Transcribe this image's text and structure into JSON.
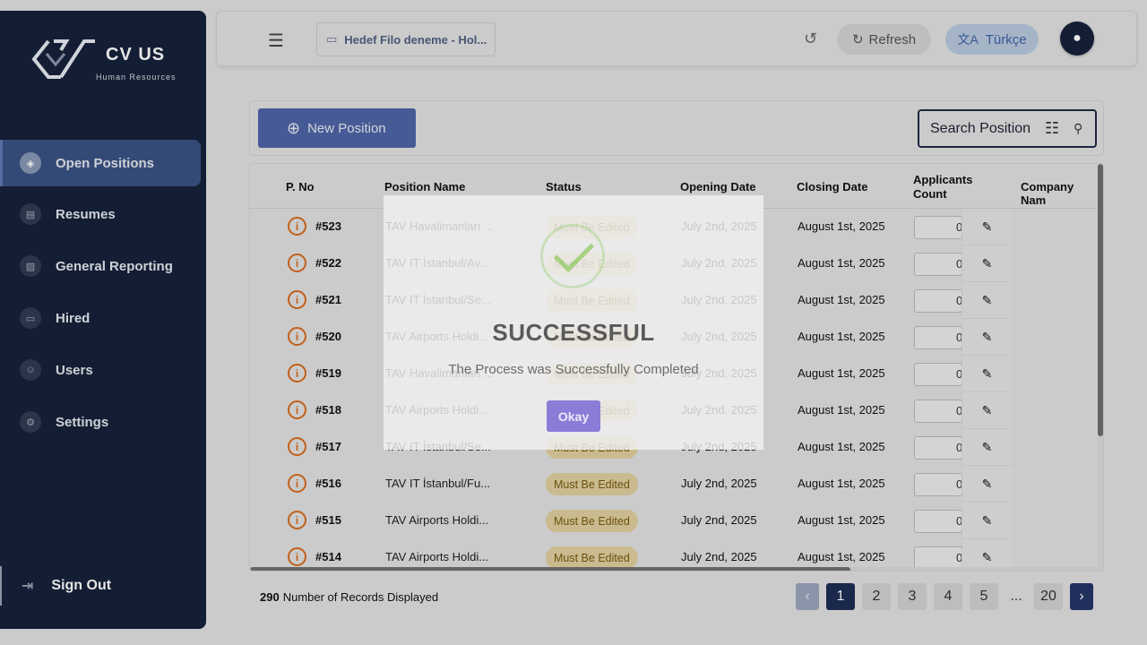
{
  "sidebar": {
    "logo_text": "CV US",
    "logo_sub": "Human Resources",
    "items": [
      {
        "label": "Open Positions",
        "icon": "layers-icon"
      },
      {
        "label": "Resumes",
        "icon": "document-icon"
      },
      {
        "label": "General Reporting",
        "icon": "chart-icon"
      },
      {
        "label": "Hired",
        "icon": "briefcase-icon"
      },
      {
        "label": "Users",
        "icon": "users-icon"
      },
      {
        "label": "Settings",
        "icon": "gear-icon"
      }
    ],
    "signout_label": "Sign Out"
  },
  "topbar": {
    "tenant_label": "Hedef Filo deneme - Hol...",
    "refresh_label": "Refresh",
    "language_label": "Türkçe"
  },
  "toolbar": {
    "new_position_label": "New Position",
    "search_label": "Search Position"
  },
  "table": {
    "headers": [
      "P. No",
      "Position Name",
      "Status",
      "Opening Date",
      "Closing Date",
      "Applicants Count",
      "Company Nam"
    ],
    "rows": [
      {
        "no": "#523",
        "name": "TAV Havalimanları ...",
        "status": "Must Be Edited",
        "opening": "July 2nd, 2025",
        "closing": "August 1st, 2025",
        "count": "0"
      },
      {
        "no": "#522",
        "name": "TAV IT İstanbul/Av...",
        "status": "Must Be Edited",
        "opening": "July 2nd, 2025",
        "closing": "August 1st, 2025",
        "count": "0"
      },
      {
        "no": "#521",
        "name": "TAV IT İstanbul/Se...",
        "status": "Must Be Edited",
        "opening": "July 2nd, 2025",
        "closing": "August 1st, 2025",
        "count": "0"
      },
      {
        "no": "#520",
        "name": "TAV Airports Holdi...",
        "status": "Must Be Edited",
        "opening": "July 2nd, 2025",
        "closing": "August 1st, 2025",
        "count": "0"
      },
      {
        "no": "#519",
        "name": "TAV Havalimanları ...",
        "status": "Must Be Edited",
        "opening": "July 2nd, 2025",
        "closing": "August 1st, 2025",
        "count": "0"
      },
      {
        "no": "#518",
        "name": "TAV Airports Holdi...",
        "status": "Must Be Edited",
        "opening": "July 2nd, 2025",
        "closing": "August 1st, 2025",
        "count": "0"
      },
      {
        "no": "#517",
        "name": "TAV IT İstanbul/Se...",
        "status": "Must Be Edited",
        "opening": "July 2nd, 2025",
        "closing": "August 1st, 2025",
        "count": "0"
      },
      {
        "no": "#516",
        "name": "TAV IT İstanbul/Fu...",
        "status": "Must Be Edited",
        "opening": "July 2nd, 2025",
        "closing": "August 1st, 2025",
        "count": "0"
      },
      {
        "no": "#515",
        "name": "TAV Airports Holdi...",
        "status": "Must Be Edited",
        "opening": "July 2nd, 2025",
        "closing": "August 1st, 2025",
        "count": "0"
      },
      {
        "no": "#514",
        "name": "TAV Airports Holdi...",
        "status": "Must Be Edited",
        "opening": "July 2nd, 2025",
        "closing": "August 1st, 2025",
        "count": "0"
      }
    ]
  },
  "footer": {
    "record_count": "290",
    "record_label": "Number of Records Displayed",
    "pages": [
      "1",
      "2",
      "3",
      "4",
      "5",
      "...",
      "20"
    ]
  },
  "modal": {
    "title": "SUCCESSFUL",
    "message": "The Process was Successfully Completed",
    "okay_label": "Okay"
  }
}
